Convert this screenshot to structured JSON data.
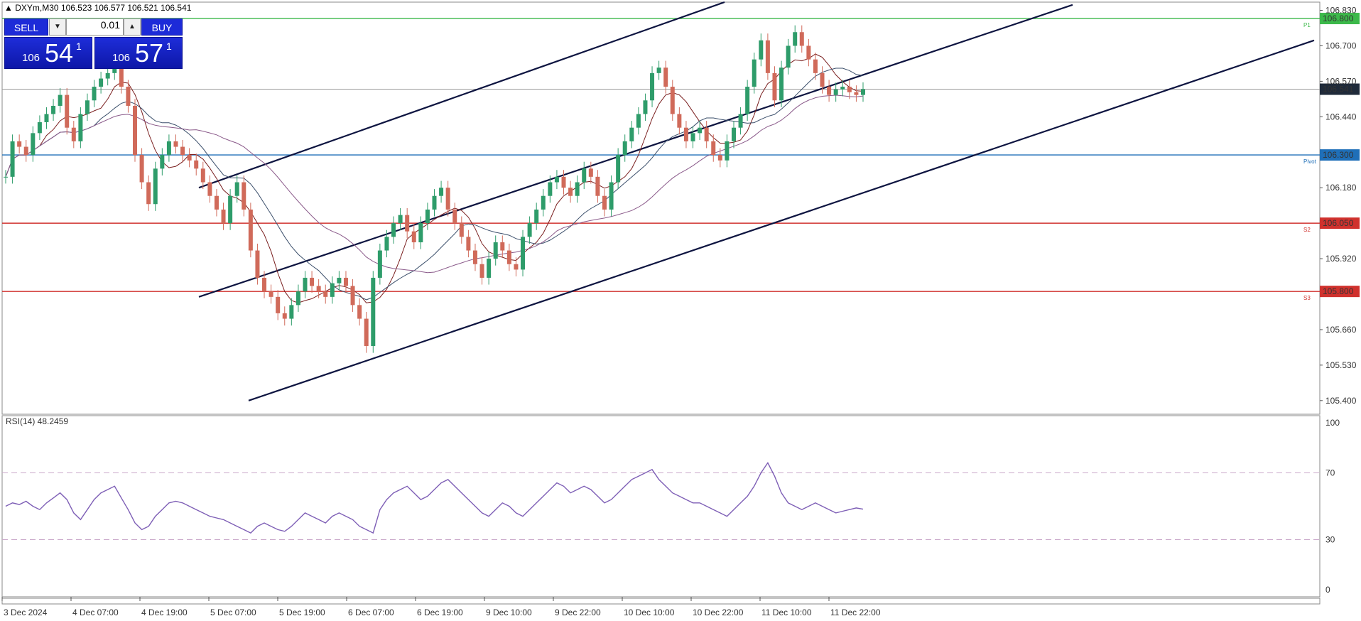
{
  "header": {
    "symbol_text": "DXYm,M30  106.523 106.577 106.521 106.541"
  },
  "trade_panel": {
    "sell_label": "SELL",
    "buy_label": "BUY",
    "lot_value": "0.01",
    "bid_small": "106",
    "bid_big": "54",
    "bid_sup": "1",
    "ask_small": "106",
    "ask_big": "57",
    "ask_sup": "1"
  },
  "chart_data": {
    "type": "candlestick",
    "price_axis": {
      "ticks": [
        "106.830",
        "106.700",
        "106.570",
        "106.440",
        "106.180",
        "105.920",
        "105.660",
        "105.530",
        "105.400"
      ],
      "ylim": [
        105.35,
        106.86
      ]
    },
    "time_axis": {
      "labels": [
        "3 Dec 2024",
        "4 Dec 07:00",
        "4 Dec 19:00",
        "5 Dec 07:00",
        "5 Dec 19:00",
        "6 Dec 07:00",
        "6 Dec 19:00",
        "9 Dec 10:00",
        "9 Dec 22:00",
        "10 Dec 10:00",
        "10 Dec 22:00",
        "11 Dec 10:00",
        "11 Dec 22:00"
      ]
    },
    "levels": [
      {
        "label": "106.800",
        "tag": "P1",
        "color": "#3cb94a",
        "price": 106.8
      },
      {
        "label": "106.300",
        "tag": "Pivot",
        "color": "#1f6fb8",
        "price": 106.3
      },
      {
        "label": "106.050",
        "tag": "S2",
        "color": "#d0312d",
        "price": 106.05
      },
      {
        "label": "105.800",
        "tag": "S3",
        "color": "#d0312d",
        "price": 105.8
      }
    ],
    "current_price": {
      "label": "106.541",
      "value": 106.541
    },
    "series_close": [
      106.22,
      106.35,
      106.33,
      106.3,
      106.38,
      106.42,
      106.45,
      106.48,
      106.52,
      106.4,
      106.35,
      106.45,
      106.5,
      106.55,
      106.58,
      106.6,
      106.62,
      106.55,
      106.48,
      106.3,
      106.2,
      106.12,
      106.25,
      106.3,
      106.35,
      106.33,
      106.3,
      106.28,
      106.25,
      106.2,
      106.15,
      106.1,
      106.05,
      106.15,
      106.2,
      106.1,
      105.95,
      105.85,
      105.8,
      105.78,
      105.72,
      105.7,
      105.75,
      105.8,
      105.85,
      105.82,
      105.8,
      105.78,
      105.83,
      105.85,
      105.82,
      105.75,
      105.7,
      105.6,
      105.85,
      105.95,
      106.0,
      106.05,
      106.08,
      106.02,
      105.98,
      106.05,
      106.1,
      106.15,
      106.18,
      106.1,
      106.05,
      106.0,
      105.95,
      105.9,
      105.85,
      105.92,
      105.98,
      105.95,
      105.9,
      105.88,
      106.0,
      106.05,
      106.1,
      106.15,
      106.2,
      106.22,
      106.18,
      106.15,
      106.2,
      106.25,
      106.22,
      106.15,
      106.1,
      106.2,
      106.3,
      106.35,
      106.4,
      106.45,
      106.5,
      106.6,
      106.62,
      106.55,
      106.45,
      106.4,
      106.35,
      106.38,
      106.4,
      106.35,
      106.3,
      106.28,
      106.35,
      106.4,
      106.45,
      106.55,
      106.65,
      106.72,
      106.6,
      106.5,
      106.62,
      106.7,
      106.75,
      106.7,
      106.65,
      106.6,
      106.55,
      106.52,
      106.54,
      106.55,
      106.53,
      106.52,
      106.541
    ],
    "channel_lines": [
      {
        "from_price": 106.18,
        "to_price": 106.86,
        "note": "upper channel"
      },
      {
        "from_price": 105.78,
        "to_price": 106.85,
        "note": "middle channel"
      },
      {
        "from_price": 105.4,
        "to_price": 106.72,
        "note": "lower channel"
      }
    ],
    "rsi": {
      "title": "RSI(14) 48.2459",
      "ticks": [
        "100",
        "70",
        "30",
        "0"
      ],
      "levels": [
        70,
        30
      ],
      "values": [
        50,
        52,
        51,
        53,
        50,
        48,
        52,
        55,
        58,
        54,
        46,
        42,
        48,
        54,
        58,
        60,
        62,
        55,
        48,
        40,
        36,
        38,
        44,
        48,
        52,
        53,
        52,
        50,
        48,
        46,
        44,
        43,
        42,
        40,
        38,
        36,
        34,
        38,
        40,
        38,
        36,
        35,
        38,
        42,
        46,
        44,
        42,
        40,
        44,
        46,
        44,
        42,
        38,
        36,
        34,
        48,
        54,
        58,
        60,
        62,
        58,
        54,
        56,
        60,
        64,
        66,
        62,
        58,
        54,
        50,
        46,
        44,
        48,
        52,
        50,
        46,
        44,
        48,
        52,
        56,
        60,
        64,
        62,
        58,
        60,
        62,
        60,
        56,
        52,
        54,
        58,
        62,
        66,
        68,
        70,
        72,
        66,
        62,
        58,
        56,
        54,
        52,
        52,
        50,
        48,
        46,
        44,
        48,
        52,
        56,
        62,
        70,
        76,
        68,
        58,
        52,
        50,
        48,
        50,
        52,
        50,
        48,
        46,
        47,
        48,
        49,
        48.2459
      ]
    }
  }
}
